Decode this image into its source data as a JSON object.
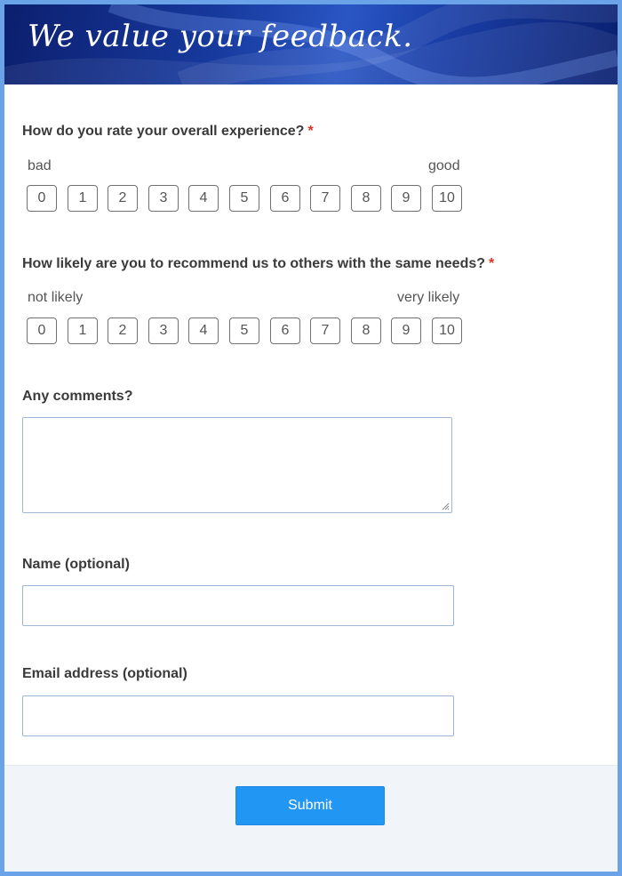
{
  "banner": {
    "title": "We value your feedback."
  },
  "q1": {
    "label": "How do you rate your overall experience?",
    "required_mark": "*",
    "low_label": "bad",
    "high_label": "good",
    "options": [
      "0",
      "1",
      "2",
      "3",
      "4",
      "5",
      "6",
      "7",
      "8",
      "9",
      "10"
    ]
  },
  "q2": {
    "label": "How likely are you to recommend us to others with the same needs?",
    "required_mark": "*",
    "low_label": "not likely",
    "high_label": "very likely",
    "options": [
      "0",
      "1",
      "2",
      "3",
      "4",
      "5",
      "6",
      "7",
      "8",
      "9",
      "10"
    ]
  },
  "comments": {
    "label": "Any comments?",
    "value": ""
  },
  "name": {
    "label": "Name (optional)",
    "value": ""
  },
  "email": {
    "label": "Email address (optional)",
    "value": ""
  },
  "footer": {
    "submit_label": "Submit"
  },
  "colors": {
    "accent": "#2196f3",
    "required": "#e0301e",
    "frame": "#6aa3e8"
  }
}
